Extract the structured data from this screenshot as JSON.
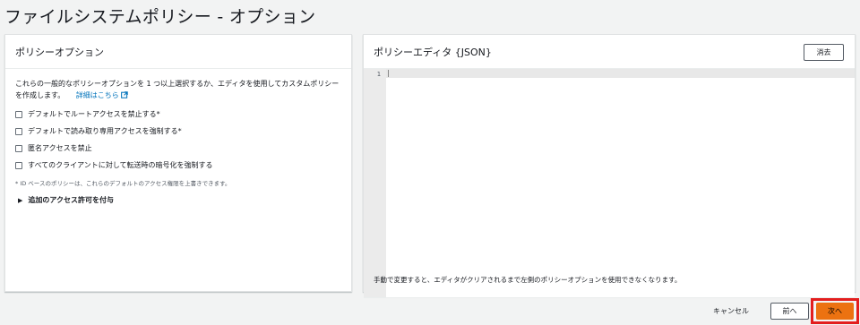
{
  "page": {
    "title": "ファイルシステムポリシー - オプション"
  },
  "left_panel": {
    "title": "ポリシーオプション",
    "description": "これらの一般的なポリシーオプションを 1 つ以上選択するか、エディタを使用してカスタムポリシーを作成します。",
    "link_label": "詳細はこちら",
    "options": [
      {
        "label": "デフォルトでルートアクセスを禁止する*",
        "checked": false
      },
      {
        "label": "デフォルトで読み取り専用アクセスを強制する*",
        "checked": false
      },
      {
        "label": "匿名アクセスを禁止",
        "checked": false
      },
      {
        "label": "すべてのクライアントに対して転送時の暗号化を強制する",
        "checked": false
      }
    ],
    "note": "* ID ベースのポリシーは、これらのデフォルトのアクセス権限を上書きできます。",
    "expand_label": "追加のアクセス許可を付与"
  },
  "right_panel": {
    "title": "ポリシーエディタ {JSON}",
    "clear_label": "消去",
    "editor": {
      "line_numbers": [
        "1"
      ],
      "content": ""
    },
    "footer_note": "手動で変更すると、エディタがクリアされるまで左側のポリシーオプションを使用できなくなります。"
  },
  "actions": {
    "cancel_label": "キャンセル",
    "prev_label": "前へ",
    "next_label": "次へ"
  },
  "colors": {
    "accent": "#ec7211",
    "link": "#0073bb",
    "highlight": "#e31e1e"
  },
  "icons": {
    "external_link": "external-link-icon",
    "expand": "caret-right-icon"
  }
}
